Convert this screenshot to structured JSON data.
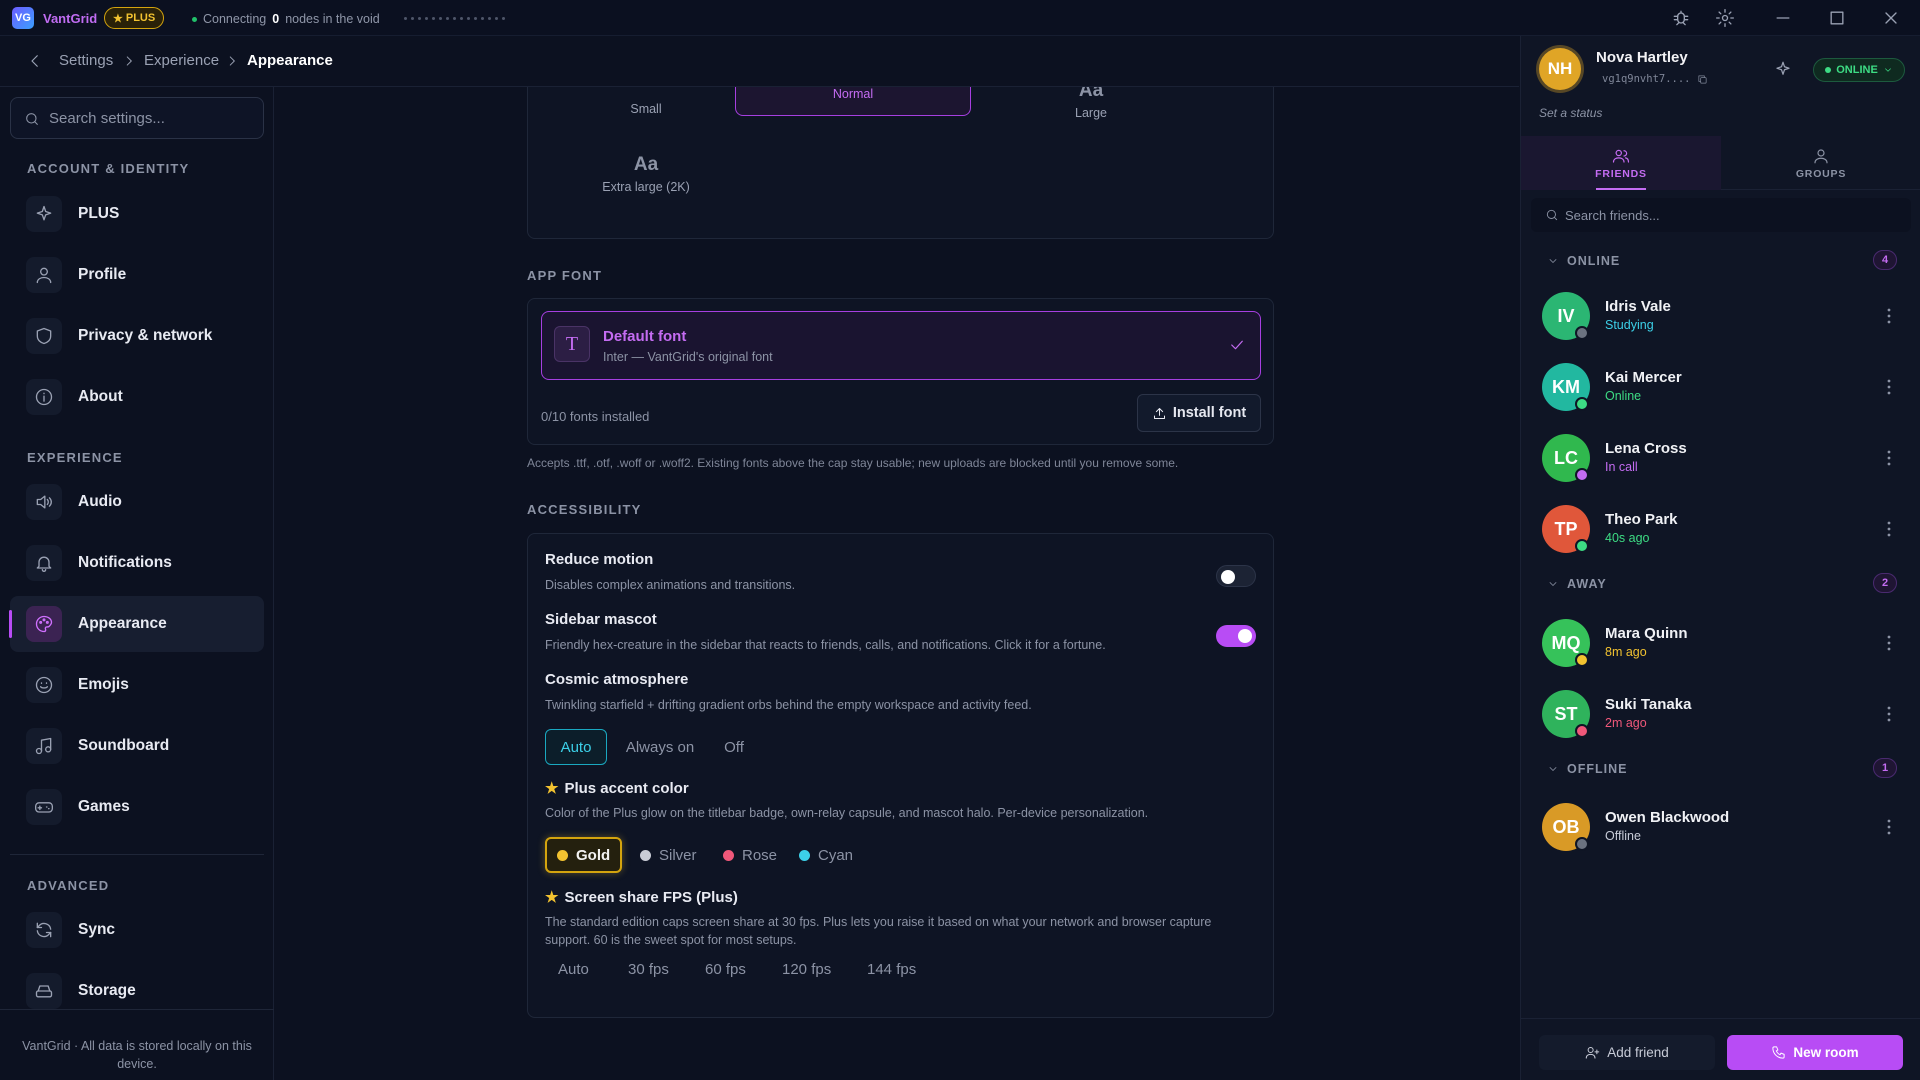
{
  "titlebar": {
    "logo": "VG",
    "app_name": "VantGrid",
    "plus_badge": "PLUS",
    "connecting_prefix": "Connecting",
    "connecting_count": "0",
    "connecting_suffix": "nodes in the void",
    "icons": [
      "bug-icon",
      "gear-icon",
      "minimize-icon",
      "maximize-icon",
      "close-icon"
    ]
  },
  "breadcrumb": [
    "Settings",
    "Experience",
    "Appearance"
  ],
  "sidebar": {
    "search_placeholder": "Search settings...",
    "sections": {
      "account": "ACCOUNT & IDENTITY",
      "experience": "EXPERIENCE",
      "advanced": "ADVANCED"
    },
    "items": [
      {
        "label": "PLUS",
        "icon": "sparkles-icon"
      },
      {
        "label": "Profile",
        "icon": "user-icon"
      },
      {
        "label": "Privacy & network",
        "icon": "shield-icon"
      },
      {
        "label": "About",
        "icon": "info-icon"
      },
      {
        "label": "Audio",
        "icon": "speaker-icon"
      },
      {
        "label": "Notifications",
        "icon": "bell-icon"
      },
      {
        "label": "Appearance",
        "icon": "palette-icon",
        "active": true
      },
      {
        "label": "Emojis",
        "icon": "smile-icon"
      },
      {
        "label": "Soundboard",
        "icon": "music-icon"
      },
      {
        "label": "Games",
        "icon": "gamepad-icon"
      },
      {
        "label": "Sync",
        "icon": "refresh-icon"
      },
      {
        "label": "Storage",
        "icon": "storage-icon"
      }
    ],
    "footer": "VantGrid · All data is stored locally on this device."
  },
  "main": {
    "text_size": {
      "options": [
        {
          "aa": "",
          "label": "Small"
        },
        {
          "aa": "",
          "label": "Normal",
          "selected": true
        },
        {
          "aa": "Aa",
          "label": "Large"
        },
        {
          "aa": "Aa",
          "label": "Extra large (2K)"
        }
      ]
    },
    "app_font": {
      "heading": "APP FONT",
      "selected_name": "Default font",
      "selected_desc": "Inter — VantGrid's original font",
      "icon_glyph": "T",
      "installed_count": "0/10 fonts installed",
      "install_button": "Install font",
      "note": "Accepts .ttf, .otf, .woff or .woff2. Existing fonts above the cap stay usable; new uploads are blocked until you remove some."
    },
    "accessibility": {
      "heading": "ACCESSIBILITY",
      "reduce_motion": {
        "title": "Reduce motion",
        "desc": "Disables complex animations and transitions.",
        "enabled": false
      },
      "sidebar_mascot": {
        "title": "Sidebar mascot",
        "desc": "Friendly hex-creature in the sidebar that reacts to friends, calls, and notifications. Click it for a fortune.",
        "enabled": true
      },
      "cosmic": {
        "title": "Cosmic atmosphere",
        "desc": "Twinkling starfield + drifting gradient orbs behind the empty workspace and activity feed.",
        "options": [
          "Auto",
          "Always on",
          "Off"
        ],
        "selected": "Auto"
      },
      "accent": {
        "title": "Plus accent color",
        "desc": "Color of the Plus glow on the titlebar badge, own-relay capsule, and mascot halo. Per-device personalization.",
        "options": [
          {
            "label": "Gold",
            "color": "#f2c230"
          },
          {
            "label": "Silver",
            "color": "#c9ccd6"
          },
          {
            "label": "Rose",
            "color": "#f0587a"
          },
          {
            "label": "Cyan",
            "color": "#3cd0e8"
          }
        ],
        "selected": "Gold"
      },
      "fps": {
        "title": "Screen share FPS (Plus)",
        "desc": "The standard edition caps screen share at 30 fps. Plus lets you raise it based on what your network and browser capture support. 60 is the sweet spot for most setups.",
        "options": [
          "Auto",
          "30 fps",
          "60 fps",
          "120 fps",
          "144 fps"
        ]
      }
    }
  },
  "right_panel": {
    "me": {
      "initials": "NH",
      "name": "Nova Hartley",
      "handle": "vg1q9nvht7....",
      "status": "ONLINE",
      "set_status": "Set a status"
    },
    "tabs": [
      {
        "label": "FRIENDS",
        "icon": "users-icon"
      },
      {
        "label": "GROUPS",
        "icon": "group-icon"
      }
    ],
    "search_placeholder": "Search friends...",
    "groups": [
      {
        "name": "ONLINE",
        "count": "4"
      },
      {
        "name": "AWAY",
        "count": "2"
      },
      {
        "name": "OFFLINE",
        "count": "1"
      }
    ],
    "friends": [
      {
        "initials": "IV",
        "name": "Idris Vale",
        "status": "Studying",
        "status_color": "#3cd0e8",
        "avatar": "#2bb673",
        "dot": "#6b7280"
      },
      {
        "initials": "KM",
        "name": "Kai Mercer",
        "status": "Online",
        "status_color": "#3ddc84",
        "avatar": "#22b8a0",
        "dot": "#3ddc84"
      },
      {
        "initials": "LC",
        "name": "Lena Cross",
        "status": "In call",
        "status_color": "#c46cf2",
        "avatar": "#30b84e",
        "dot": "#c46cf2"
      },
      {
        "initials": "TP",
        "name": "Theo Park",
        "status": "40s ago",
        "status_color": "#3ddc84",
        "avatar": "#e0573a",
        "dot": "#3ddc84"
      },
      {
        "initials": "MQ",
        "name": "Mara Quinn",
        "status": "8m ago",
        "status_color": "#f2c230",
        "avatar": "#36c25a",
        "dot": "#f2c230"
      },
      {
        "initials": "ST",
        "name": "Suki Tanaka",
        "status": "2m ago",
        "status_color": "#f0587a",
        "avatar": "#2fb35c",
        "dot": "#f0587a"
      },
      {
        "initials": "OB",
        "name": "Owen Blackwood",
        "status": "Offline",
        "status_color": "#c8ccd8",
        "avatar": "#d99a26",
        "dot": "#6b7280"
      }
    ],
    "buttons": {
      "add_friend": "Add friend",
      "new_room": "New room"
    }
  }
}
